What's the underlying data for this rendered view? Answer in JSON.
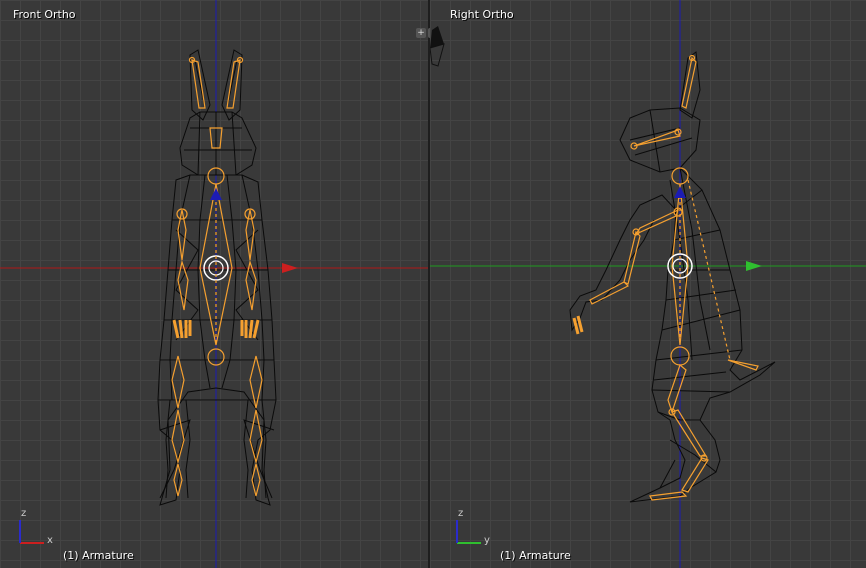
{
  "viewports": {
    "left": {
      "title": "Front Ortho",
      "status": "(1) Armature",
      "axis_x_label": "x",
      "axis_z_label": "z"
    },
    "right": {
      "title": "Right Ortho",
      "status": "(1) Armature",
      "axis_y_label": "y",
      "axis_z_label": "z"
    }
  },
  "colors": {
    "background": "#393939",
    "grid": "#444444",
    "wire": "#000000",
    "bone": "#f5a030",
    "x_axis": "#cc1f1f",
    "y_axis": "#2fbf2f",
    "z_axis": "#2b2bcc"
  }
}
